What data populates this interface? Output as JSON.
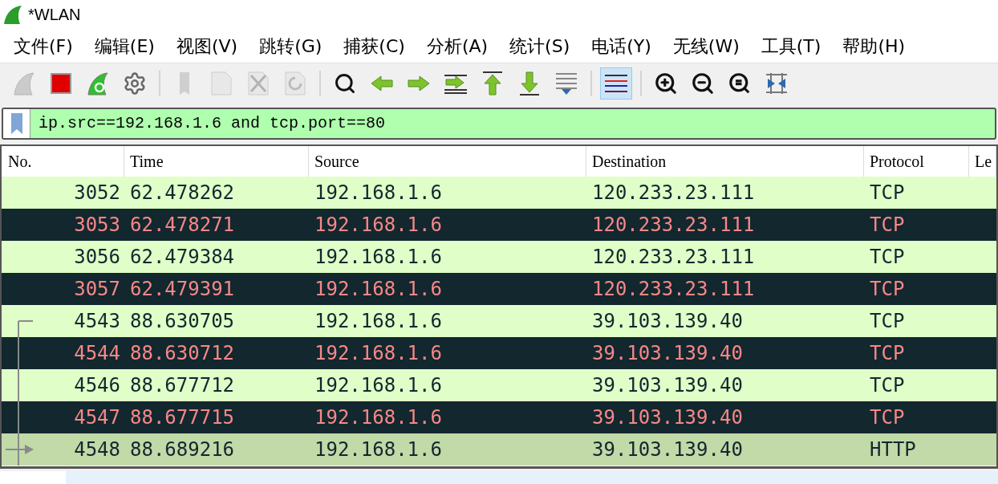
{
  "window": {
    "title": "*WLAN"
  },
  "menu": [
    "文件(F)",
    "编辑(E)",
    "视图(V)",
    "跳转(G)",
    "捕获(C)",
    "分析(A)",
    "统计(S)",
    "电话(Y)",
    "无线(W)",
    "工具(T)",
    "帮助(H)"
  ],
  "toolbar": [
    {
      "kind": "start",
      "disabled": true,
      "active": false
    },
    {
      "kind": "stop",
      "disabled": false,
      "active": false
    },
    {
      "kind": "restart",
      "disabled": false,
      "active": false
    },
    {
      "kind": "options",
      "disabled": false,
      "active": false
    },
    {
      "kind": "sep"
    },
    {
      "kind": "open",
      "disabled": true,
      "active": false
    },
    {
      "kind": "file",
      "disabled": true,
      "active": false
    },
    {
      "kind": "close",
      "disabled": true,
      "active": false
    },
    {
      "kind": "reload",
      "disabled": true,
      "active": false
    },
    {
      "kind": "sep"
    },
    {
      "kind": "find",
      "disabled": false,
      "active": false
    },
    {
      "kind": "back",
      "disabled": false,
      "active": false
    },
    {
      "kind": "forward",
      "disabled": false,
      "active": false
    },
    {
      "kind": "goto",
      "disabled": false,
      "active": false
    },
    {
      "kind": "first",
      "disabled": false,
      "active": false
    },
    {
      "kind": "last",
      "disabled": false,
      "active": false
    },
    {
      "kind": "autoscroll",
      "disabled": false,
      "active": false
    },
    {
      "kind": "sep"
    },
    {
      "kind": "colorize",
      "disabled": false,
      "active": true
    },
    {
      "kind": "sep"
    },
    {
      "kind": "zoom-in",
      "disabled": false,
      "active": false
    },
    {
      "kind": "zoom-out",
      "disabled": false,
      "active": false
    },
    {
      "kind": "zoom-reset",
      "disabled": false,
      "active": false
    },
    {
      "kind": "resize",
      "disabled": false,
      "active": false
    }
  ],
  "filter": {
    "value": "ip.src==192.168.1.6 and tcp.port==80"
  },
  "table": {
    "columns": [
      "No.",
      "Time",
      "Source",
      "Destination",
      "Protocol",
      "Le"
    ],
    "rows": [
      {
        "kind": "light",
        "related": false,
        "cells": [
          "3052",
          "62.478262",
          "192.168.1.6",
          "120.233.23.111",
          "TCP"
        ]
      },
      {
        "kind": "dark",
        "related": false,
        "cells": [
          "3053",
          "62.478271",
          "192.168.1.6",
          "120.233.23.111",
          "TCP"
        ]
      },
      {
        "kind": "light",
        "related": false,
        "cells": [
          "3056",
          "62.479384",
          "192.168.1.6",
          "120.233.23.111",
          "TCP"
        ]
      },
      {
        "kind": "dark",
        "related": false,
        "cells": [
          "3057",
          "62.479391",
          "192.168.1.6",
          "120.233.23.111",
          "TCP"
        ]
      },
      {
        "kind": "light",
        "related": true,
        "cells": [
          "4543",
          "88.630705",
          "192.168.1.6",
          "39.103.139.40",
          "TCP"
        ]
      },
      {
        "kind": "dark",
        "related": true,
        "cells": [
          "4544",
          "88.630712",
          "192.168.1.6",
          "39.103.139.40",
          "TCP"
        ]
      },
      {
        "kind": "light",
        "related": true,
        "cells": [
          "4546",
          "88.677712",
          "192.168.1.6",
          "39.103.139.40",
          "TCP"
        ]
      },
      {
        "kind": "dark",
        "related": true,
        "cells": [
          "4547",
          "88.677715",
          "192.168.1.6",
          "39.103.139.40",
          "TCP"
        ]
      },
      {
        "kind": "http",
        "related": true,
        "cells": [
          "4548",
          "88.689216",
          "192.168.1.6",
          "39.103.139.40",
          "HTTP"
        ]
      }
    ]
  }
}
